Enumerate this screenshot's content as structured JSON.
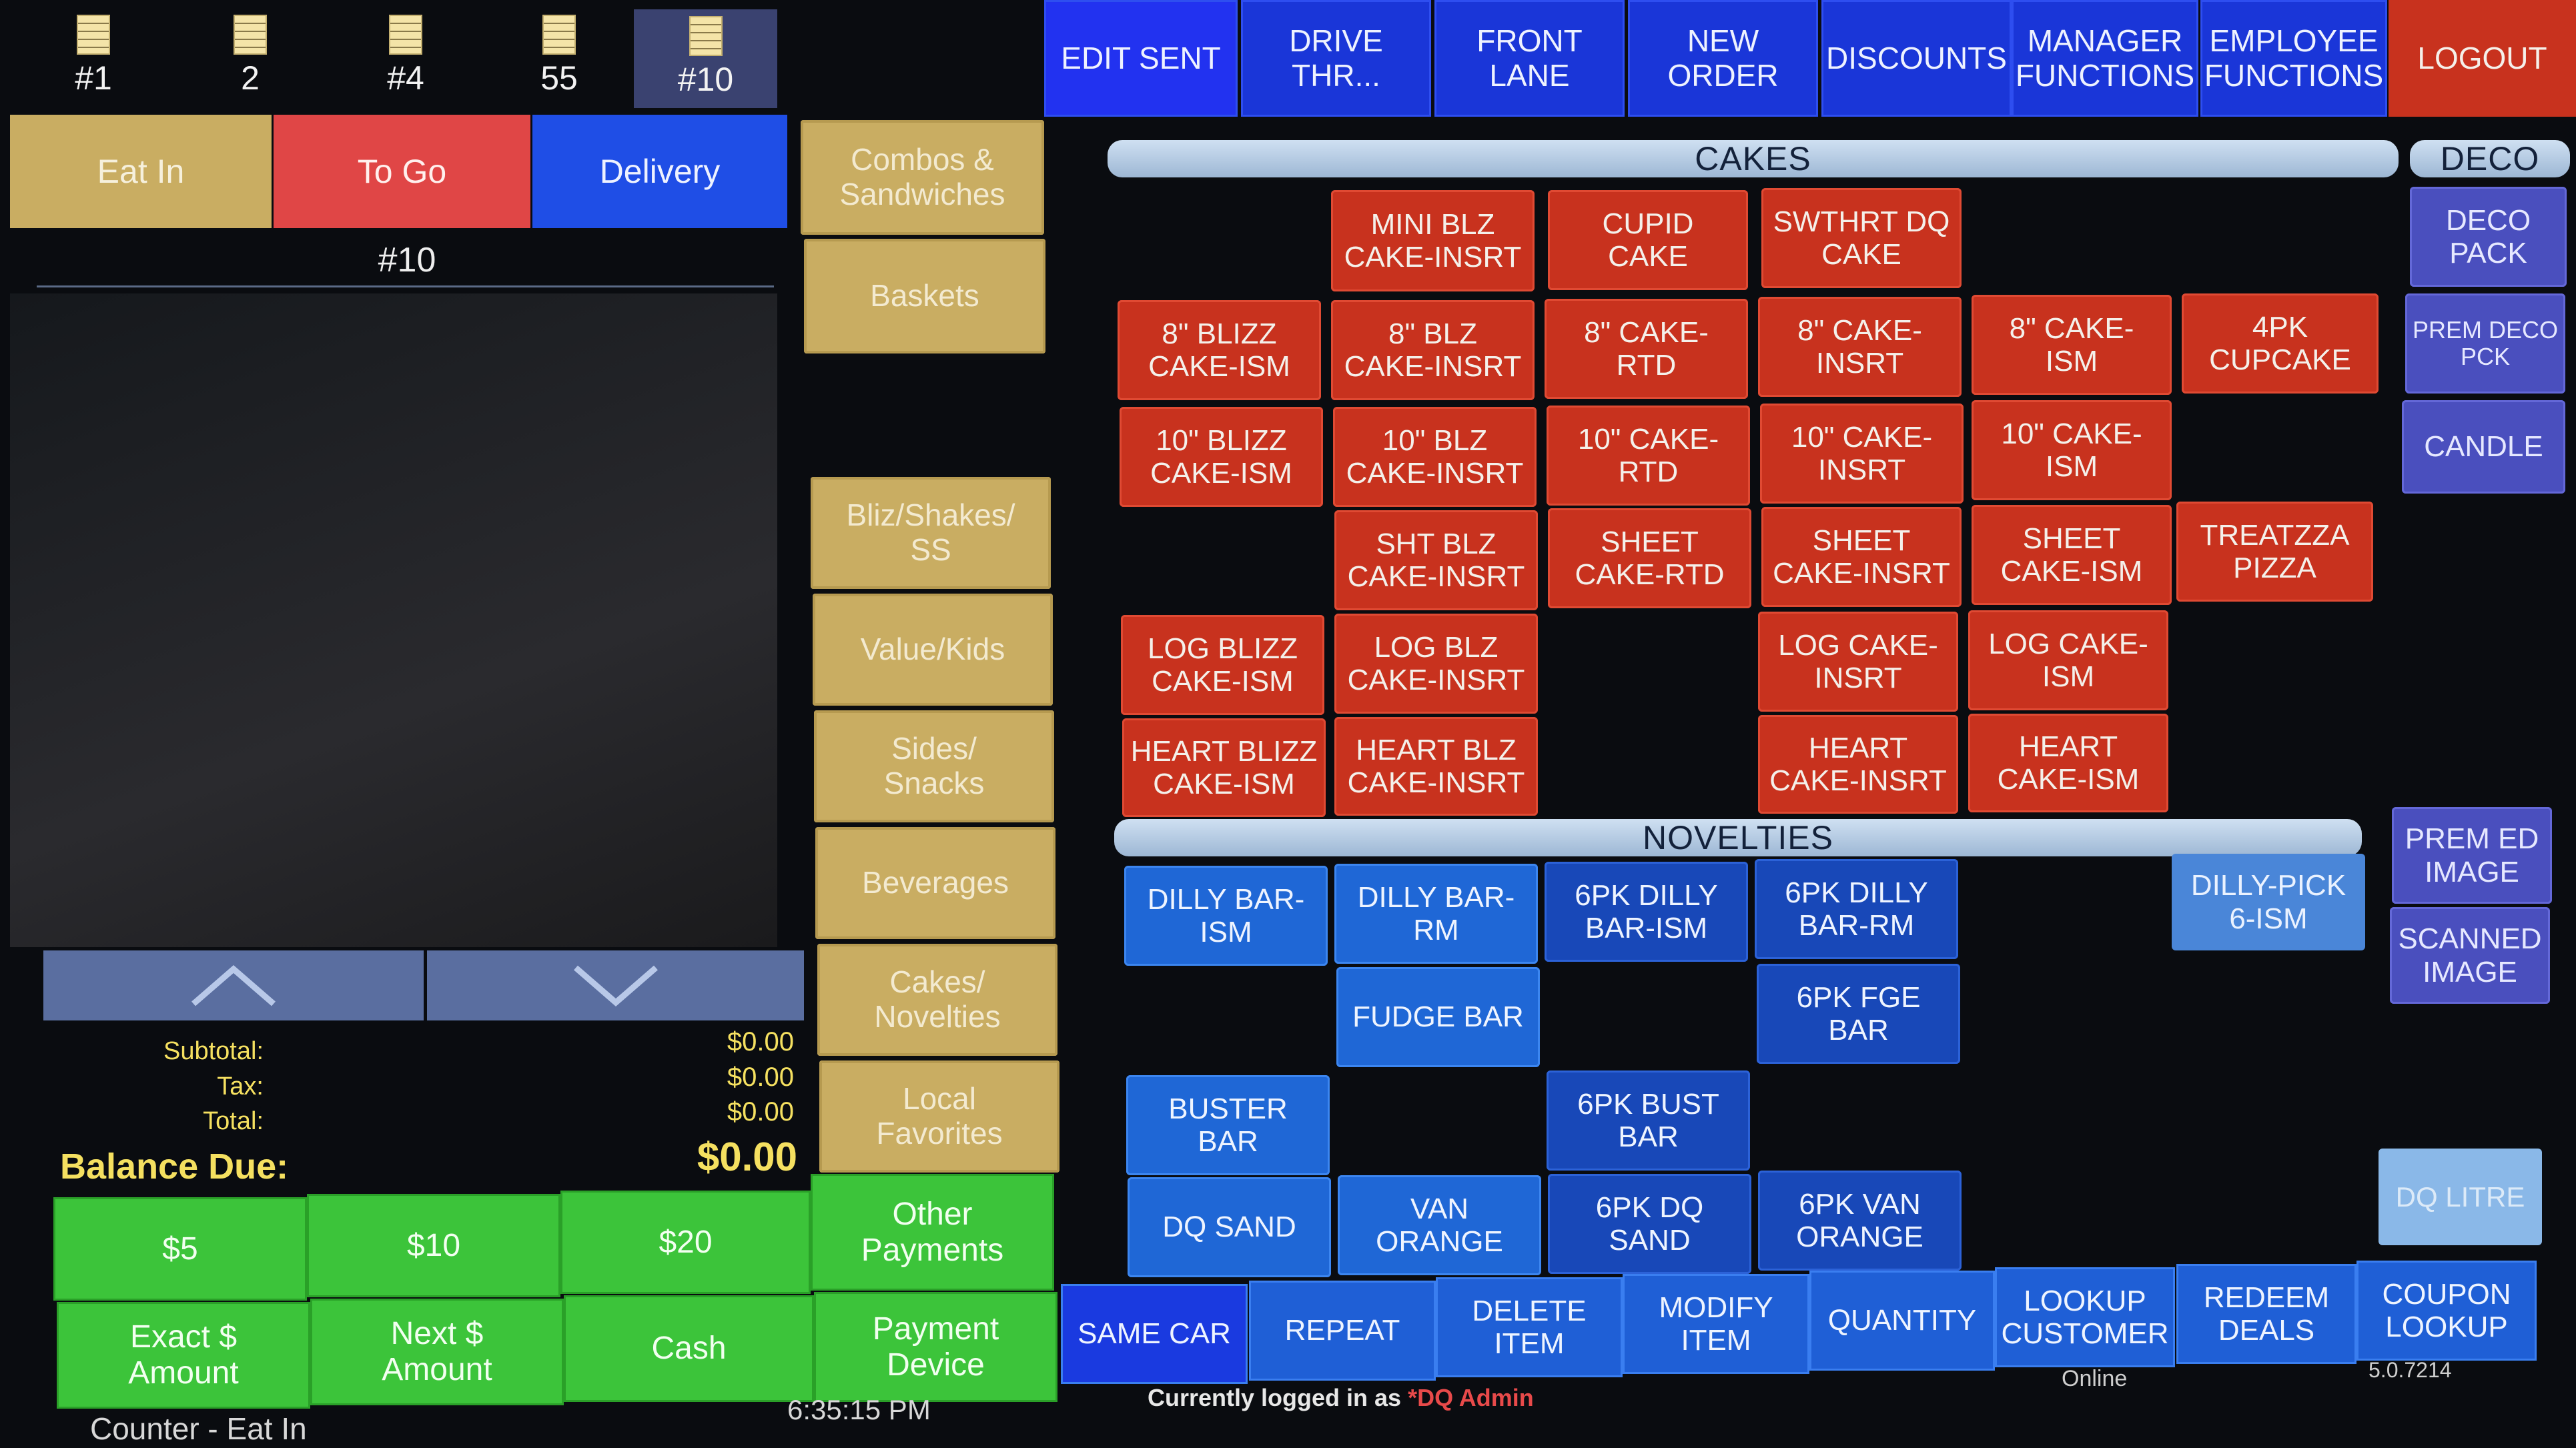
{
  "tickets": [
    {
      "label": "#1"
    },
    {
      "label": "2"
    },
    {
      "label": "#4"
    },
    {
      "label": "55"
    },
    {
      "label": "#10"
    }
  ],
  "top_nav": {
    "edit_sent": "EDIT SENT",
    "drive_thru": "DRIVE\nTHR...",
    "front_lane": "FRONT\nLANE",
    "new_order": "NEW\nORDER",
    "discounts": "DISCOUNTS",
    "manager_functions": "MANAGER\nFUNCTIONS",
    "employee_functions": "EMPLOYEE\nFUNCTIONS",
    "logout": "LOGOUT"
  },
  "order_type": {
    "eat_in": "Eat In",
    "to_go": "To Go",
    "delivery": "Delivery"
  },
  "order_number": "#10",
  "categories": {
    "combos": "Combos &\nSandwiches",
    "baskets": "Baskets",
    "bliz": "Bliz/Shakes/\nSS",
    "value_kids": "Value/Kids",
    "sides": "Sides/\nSnacks",
    "beverages": "Beverages",
    "cakes_novelties": "Cakes/\nNovelties",
    "local_favorites": "Local\nFavorites"
  },
  "totals": {
    "subtotal_label": "Subtotal:",
    "subtotal": "$0.00",
    "tax_label": "Tax:",
    "tax": "$0.00",
    "total_label": "Total:",
    "total": "$0.00",
    "balance_label": "Balance Due:",
    "balance": "$0.00"
  },
  "payment": {
    "five": "$5",
    "ten": "$10",
    "twenty": "$20",
    "other": "Other\nPayments",
    "exact": "Exact $\nAmount",
    "next": "Next $\nAmount",
    "cash": "Cash",
    "device": "Payment\nDevice"
  },
  "status": {
    "mode": "Counter - Eat In",
    "time": "6:35:15 PM",
    "logged_in_prefix": "Currently logged in as",
    "logged_in_user": "*DQ Admin",
    "online": "Online",
    "version": "5.0.7214"
  },
  "sections": {
    "cakes": "CAKES",
    "deco": "DECO",
    "novelties": "NOVELTIES"
  },
  "cakes": {
    "mini_blz": "MINI BLZ\nCAKE-INSRT",
    "cupid": "CUPID\nCAKE",
    "swthrt": "SWTHRT DQ\nCAKE",
    "b8_blizz_ism": "8\" BLIZZ\nCAKE-ISM",
    "b8_blz_insrt": "8\" BLZ\nCAKE-INSRT",
    "c8_rtd": "8\" CAKE-\nRTD",
    "c8_insrt": "8\" CAKE-\nINSRT",
    "c8_ism": "8\" CAKE-\nISM",
    "cupcake4": "4PK\nCUPCAKE",
    "b10_blizz_ism": "10\" BLIZZ\nCAKE-ISM",
    "b10_blz_insrt": "10\" BLZ\nCAKE-INSRT",
    "c10_rtd": "10\" CAKE-\nRTD",
    "c10_insrt": "10\" CAKE-\nINSRT",
    "c10_ism": "10\" CAKE-\nISM",
    "sht_blz_insrt": "SHT BLZ\nCAKE-INSRT",
    "sheet_rtd": "SHEET\nCAKE-RTD",
    "sheet_insrt": "SHEET\nCAKE-INSRT",
    "sheet_ism": "SHEET\nCAKE-ISM",
    "treatzza": "TREATZZA\nPIZZA",
    "log_blizz_ism": "LOG BLIZZ\nCAKE-ISM",
    "log_blz_insrt": "LOG BLZ\nCAKE-INSRT",
    "log_insrt": "LOG CAKE-\nINSRT",
    "log_ism": "LOG CAKE-\nISM",
    "heart_blizz_ism": "HEART BLIZZ\nCAKE-ISM",
    "heart_blz_insrt": "HEART BLZ\nCAKE-INSRT",
    "heart_insrt": "HEART\nCAKE-INSRT",
    "heart_ism": "HEART\nCAKE-ISM"
  },
  "deco": {
    "deco_pack": "DECO\nPACK",
    "prem_deco": "PREM DECO\nPCK",
    "candle": "CANDLE"
  },
  "novelties": {
    "dilly_ism": "DILLY BAR-\nISM",
    "dilly_rm": "DILLY BAR-\nRM",
    "dilly6_ism": "6PK DILLY\nBAR-ISM",
    "dilly6_rm": "6PK DILLY\nBAR-RM",
    "dillypick": "DILLY-PICK\n6-ISM",
    "fudge": "FUDGE BAR",
    "fge6": "6PK FGE\nBAR",
    "buster": "BUSTER\nBAR",
    "bust6": "6PK BUST\nBAR",
    "dqsand": "DQ SAND",
    "van_orange": "VAN\nORANGE",
    "dqsand6": "6PK DQ\nSAND",
    "van_orange6": "6PK VAN\nORANGE",
    "prem_ed": "PREM ED\nIMAGE",
    "scanned": "SCANNED\nIMAGE",
    "dq_litre": "DQ LITRE"
  },
  "bottom": {
    "same_car": "SAME CAR",
    "repeat": "REPEAT",
    "delete": "DELETE\nITEM",
    "modify": "MODIFY\nITEM",
    "quantity": "QUANTITY",
    "lookup": "LOOKUP\nCUSTOMER",
    "redeem": "REDEEM\nDEALS",
    "coupon": "COUPON\nLOOKUP"
  },
  "icons": {
    "ticket": "order-ticket-icon",
    "up": "chevron-up-icon",
    "down": "chevron-down-icon"
  }
}
